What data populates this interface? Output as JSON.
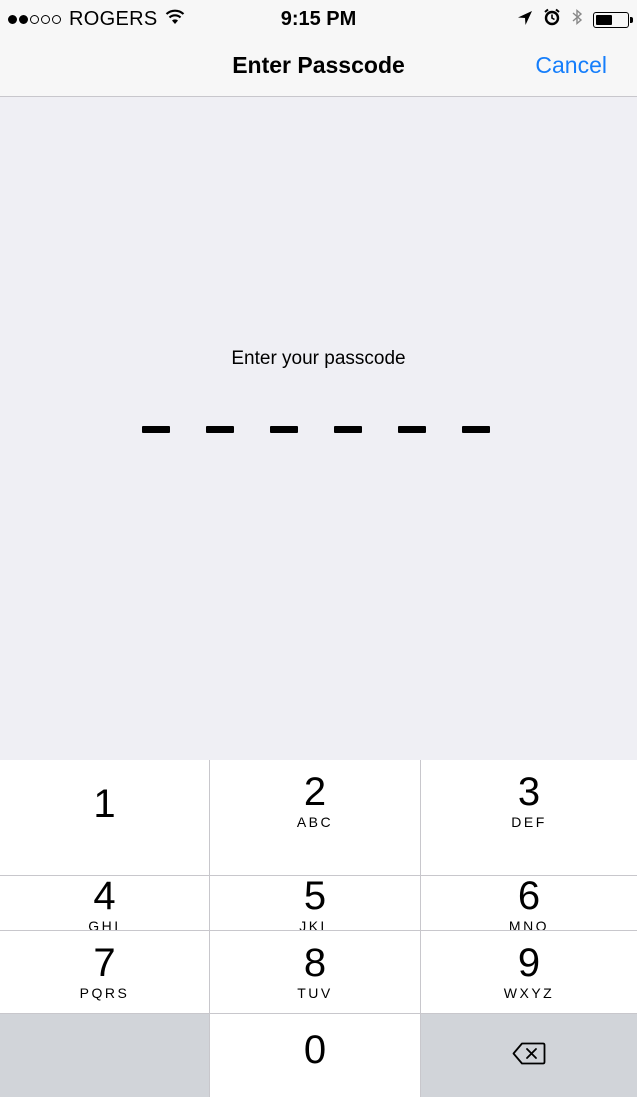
{
  "status_bar": {
    "carrier": "ROGERS",
    "time": "9:15 PM",
    "signal_bars_filled": 2,
    "signal_bars_total": 5,
    "battery_level": 0.55,
    "icons": [
      "signal-dots-icon",
      "wifi-icon",
      "location-arrow-icon",
      "alarm-icon",
      "bluetooth-icon",
      "battery-icon"
    ]
  },
  "nav": {
    "title": "Enter Passcode",
    "cancel_label": "Cancel"
  },
  "passcode": {
    "prompt": "Enter your passcode",
    "length": 6,
    "entered": 0
  },
  "keypad": {
    "keys": [
      {
        "num": "1",
        "letters": ""
      },
      {
        "num": "2",
        "letters": "ABC"
      },
      {
        "num": "3",
        "letters": "DEF"
      },
      {
        "num": "4",
        "letters": "GHI"
      },
      {
        "num": "5",
        "letters": "JKL"
      },
      {
        "num": "6",
        "letters": "MNO"
      },
      {
        "num": "7",
        "letters": "PQRS"
      },
      {
        "num": "8",
        "letters": "TUV"
      },
      {
        "num": "9",
        "letters": "WXYZ"
      },
      {
        "num": "0",
        "letters": ""
      }
    ],
    "backspace_icon": "backspace-icon"
  },
  "colors": {
    "accent": "#157efb",
    "background": "#efeff4",
    "keypad_dark": "#d1d4d9"
  }
}
